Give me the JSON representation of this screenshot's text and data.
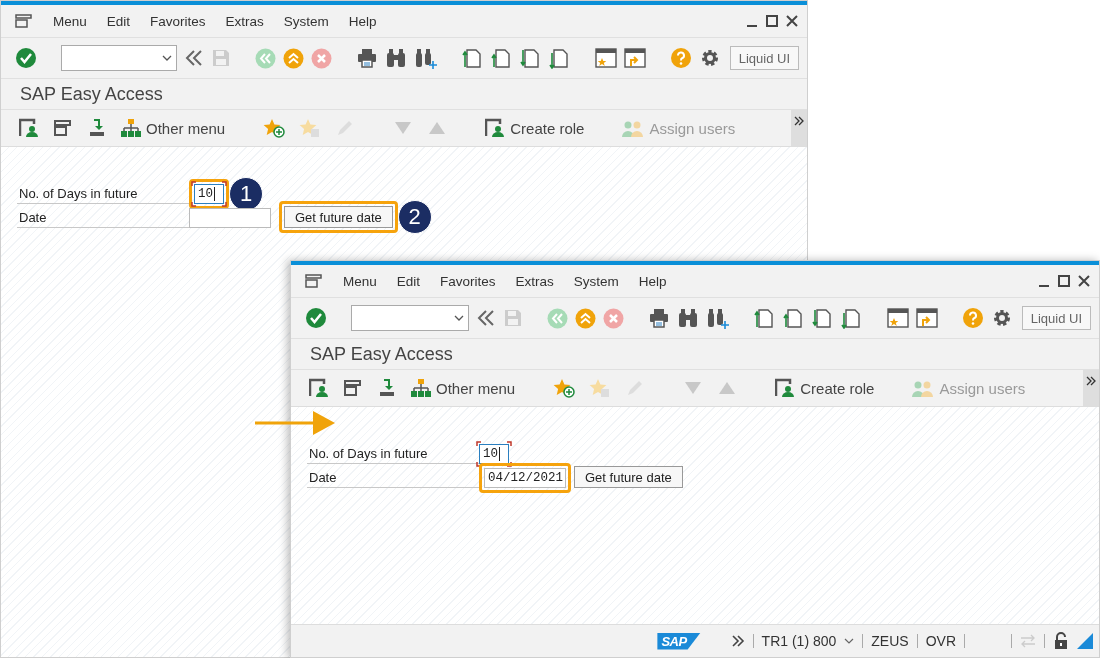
{
  "windows": [
    {
      "menu": [
        "Menu",
        "Edit",
        "Favorites",
        "Extras",
        "System",
        "Help"
      ],
      "liquid_ui": "Liquid UI",
      "title": "SAP Easy Access",
      "app_buttons": [
        {
          "label": "Other menu",
          "disabled": false
        },
        {
          "label": "Create role",
          "disabled": false
        },
        {
          "label": "Assign users",
          "disabled": true
        }
      ],
      "form": {
        "arrow": false,
        "fields": [
          {
            "label": "No. of Days in future",
            "value": "10",
            "focused": true,
            "highlighted": true,
            "step": "1"
          },
          {
            "label": "Date",
            "focused": false,
            "highlighted": false
          }
        ],
        "button": {
          "label": "Get future date",
          "highlighted": true,
          "step": "2"
        }
      }
    },
    {
      "menu": [
        "Menu",
        "Edit",
        "Favorites",
        "Extras",
        "System",
        "Help"
      ],
      "liquid_ui": "Liquid UI",
      "title": "SAP Easy Access",
      "app_buttons": [
        {
          "label": "Other menu",
          "disabled": false
        },
        {
          "label": "Create role",
          "disabled": false
        },
        {
          "label": "Assign users",
          "disabled": true
        }
      ],
      "form": {
        "arrow": true,
        "fields": [
          {
            "label": "No. of Days in future",
            "value": "10",
            "focused": true,
            "highlighted": false
          },
          {
            "label": "Date",
            "value": "04/12/2021",
            "focused": false,
            "highlighted": true
          }
        ],
        "button": {
          "label": "Get future date",
          "highlighted": false
        }
      },
      "status_bar": {
        "logo": "SAP",
        "system": "TR1 (1) 800",
        "server": "ZEUS",
        "mode": "OVR"
      }
    }
  ]
}
